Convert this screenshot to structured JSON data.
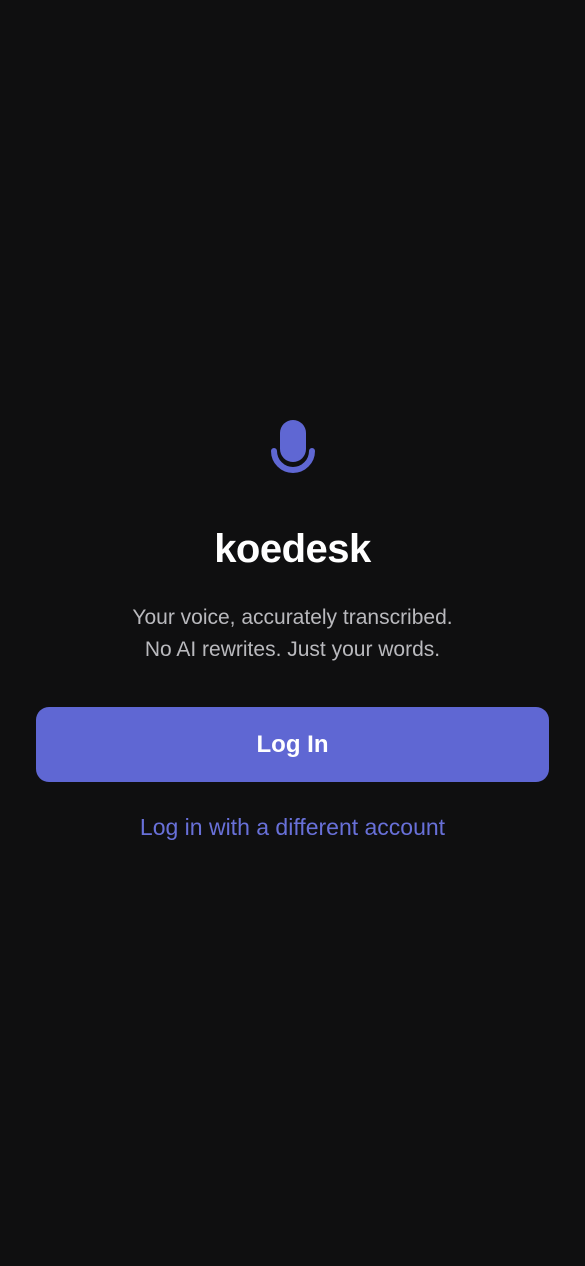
{
  "app": {
    "icon": "microphone-icon",
    "name": "koedesk",
    "tagline_line1": "Your voice, accurately transcribed.",
    "tagline_line2": "No AI rewrites. Just your words."
  },
  "actions": {
    "login_label": "Log In",
    "alt_login_label": "Log in with a different account"
  },
  "colors": {
    "background": "#0f0f10",
    "accent": "#5f67d3",
    "link": "#6870d8",
    "title": "#ffffff",
    "tagline": "#b9b9bd"
  }
}
